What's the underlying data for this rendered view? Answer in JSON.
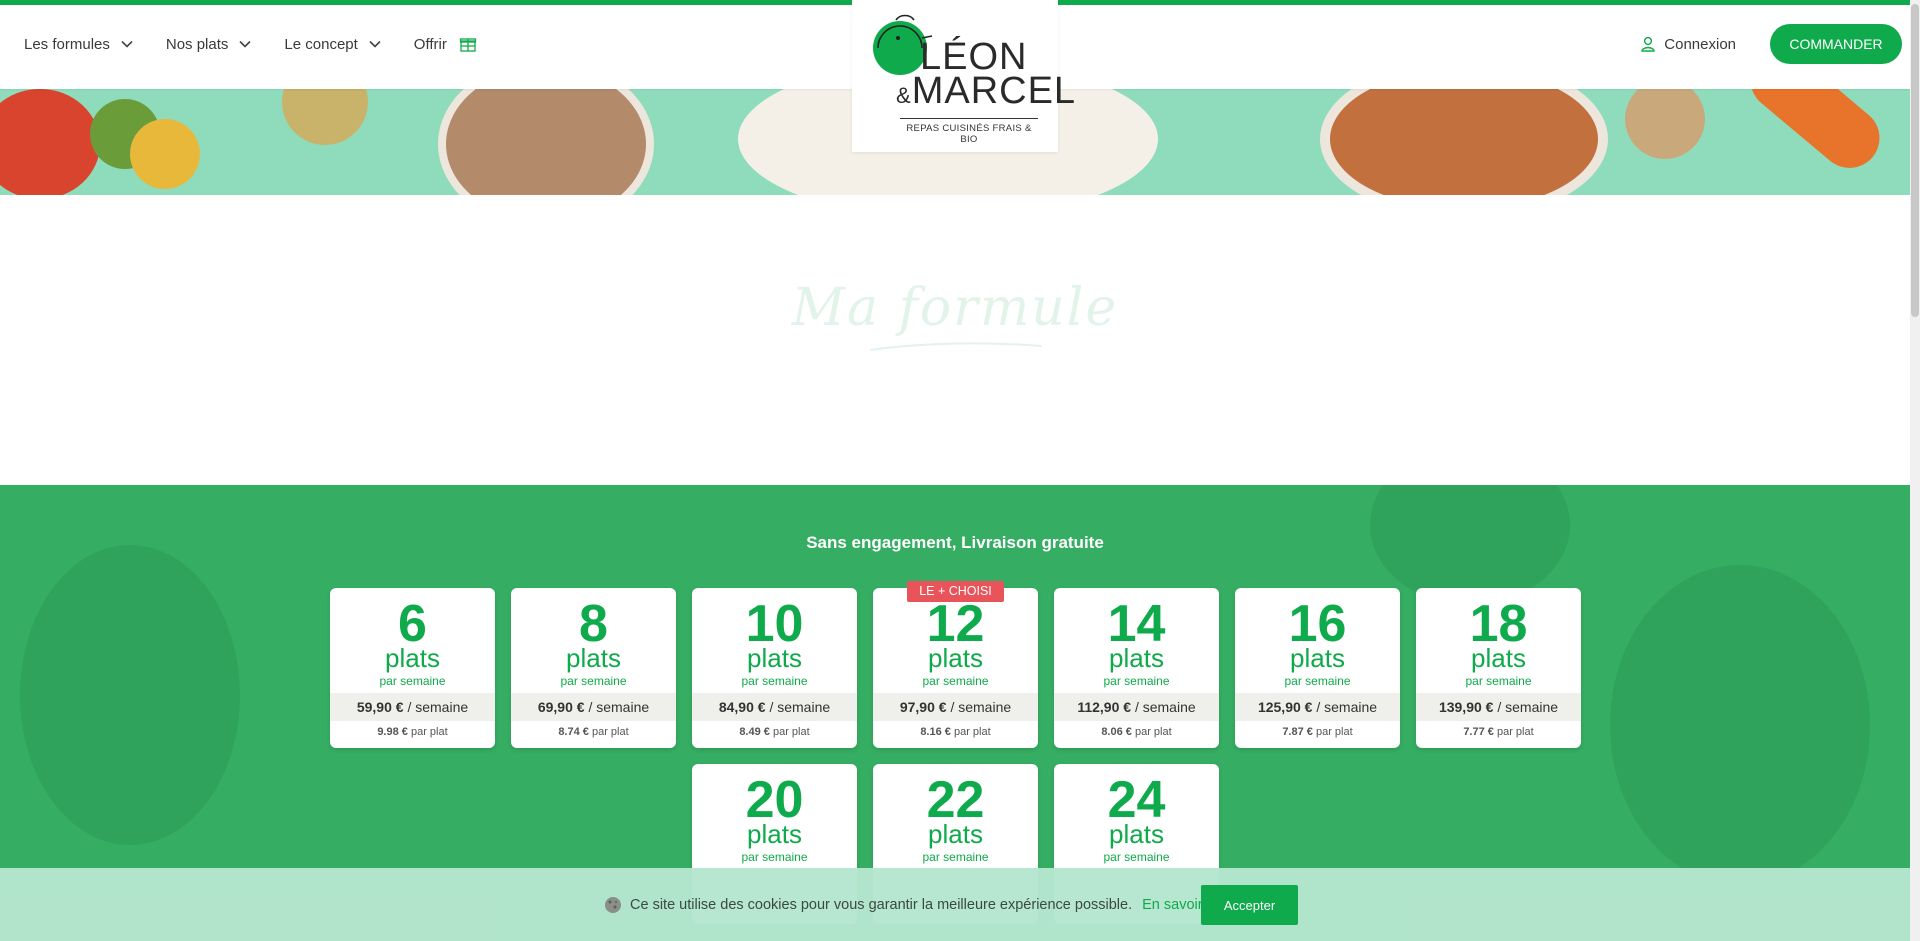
{
  "nav": {
    "items": [
      {
        "label": "Les formules",
        "icon": "chevron-down-icon"
      },
      {
        "label": "Nos plats",
        "icon": "chevron-down-icon"
      },
      {
        "label": "Le concept",
        "icon": "chevron-down-icon"
      },
      {
        "label": "Offrir",
        "icon": "gift-icon"
      }
    ]
  },
  "logo": {
    "line1": "LÉON",
    "amp": "&",
    "line2": "MARCEL",
    "tagline": "REPAS CUISINÉS FRAIS & BIO"
  },
  "header": {
    "login_label": "Connexion",
    "order_label": "COMMANDER"
  },
  "section": {
    "title": "Ma formule",
    "subtitle": "Sans engagement, Livraison gratuite"
  },
  "formulas": [
    {
      "count": "6",
      "unit": "plats",
      "per": "par semaine",
      "price": "59,90 €",
      "price_suffix": "/ semaine",
      "per_dish": "9.98 €",
      "per_dish_suffix": "par plat"
    },
    {
      "count": "8",
      "unit": "plats",
      "per": "par semaine",
      "price": "69,90 €",
      "price_suffix": "/ semaine",
      "per_dish": "8.74 €",
      "per_dish_suffix": "par plat"
    },
    {
      "count": "10",
      "unit": "plats",
      "per": "par semaine",
      "price": "84,90 €",
      "price_suffix": "/ semaine",
      "per_dish": "8.49 €",
      "per_dish_suffix": "par plat"
    },
    {
      "count": "12",
      "unit": "plats",
      "per": "par semaine",
      "price": "97,90 €",
      "price_suffix": "/ semaine",
      "per_dish": "8.16 €",
      "per_dish_suffix": "par plat",
      "badge": "LE + CHOISI"
    },
    {
      "count": "14",
      "unit": "plats",
      "per": "par semaine",
      "price": "112,90 €",
      "price_suffix": "/ semaine",
      "per_dish": "8.06 €",
      "per_dish_suffix": "par plat"
    },
    {
      "count": "16",
      "unit": "plats",
      "per": "par semaine",
      "price": "125,90 €",
      "price_suffix": "/ semaine",
      "per_dish": "7.87 €",
      "per_dish_suffix": "par plat"
    },
    {
      "count": "18",
      "unit": "plats",
      "per": "par semaine",
      "price": "139,90 €",
      "price_suffix": "/ semaine",
      "per_dish": "7.77 €",
      "per_dish_suffix": "par plat"
    },
    {
      "count": "20",
      "unit": "plats",
      "per": "par semaine"
    },
    {
      "count": "22",
      "unit": "plats",
      "per": "par semaine"
    },
    {
      "count": "24",
      "unit": "plats",
      "per": "par semaine"
    }
  ],
  "cookie": {
    "message": "Ce site utilise des cookies pour vous garantir la meilleure expérience possible.",
    "more_label": "En savoir +",
    "accept_label": "Accepter"
  },
  "colors": {
    "brand_green": "#0faa4b",
    "section_green": "#35ad62",
    "badge_red": "#e9545a",
    "banner_mint": "#8fdcbd"
  }
}
